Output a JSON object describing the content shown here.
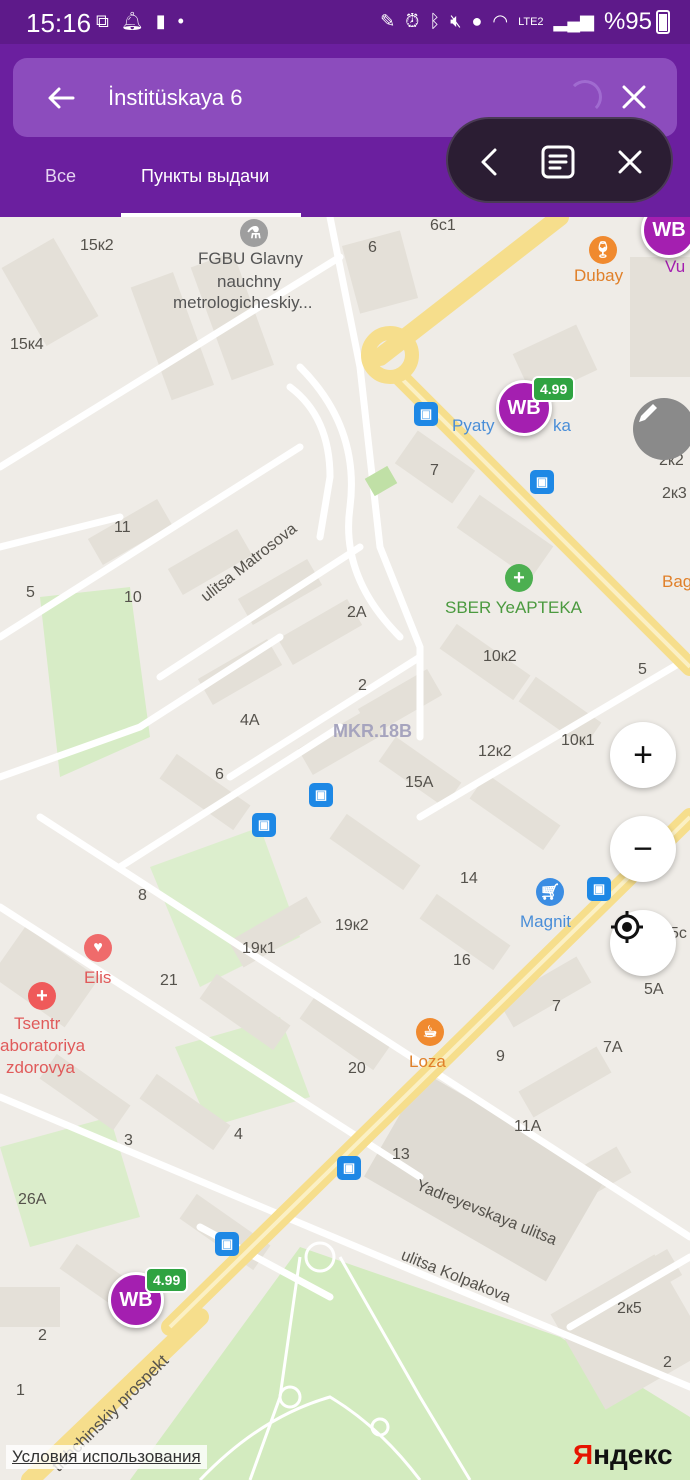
{
  "status_bar": {
    "time": "15:16",
    "battery": "%95",
    "network": "LTE2"
  },
  "search": {
    "query": "İnstitüskaya 6"
  },
  "tabs": [
    {
      "label": "Все"
    },
    {
      "label": "Пункты выдачи"
    }
  ],
  "nav_pill": {
    "back_icon": "chevron-left-icon",
    "list_icon": "list-icon",
    "close_icon": "close-icon"
  },
  "map": {
    "district": "MKR.18B",
    "streets": {
      "matrosova": "ulitsa Matrosova",
      "yadreyevskaya": "Yadreyevskaya ulitsa",
      "kolpakova": "ulitsa Kolpakova",
      "prospekt": "tishchinskiy prospekt"
    },
    "pois": {
      "fgbu_line1": "FGBU Glavny",
      "fgbu_line2": "nauchny",
      "fgbu_line3": "metrologicheskiy...",
      "dubay": "Dubay",
      "vu": "Vu",
      "pyaterochka": "Pyatyorochka",
      "pyat_start": "Pyaty",
      "pyat_end": "ka",
      "sber": "SBER YeAPTEKA",
      "bag": "Bag",
      "magnit": "Magnit",
      "elis": "Elis",
      "tsentr1": "Tsentr",
      "tsentr2": "aboratoriya",
      "tsentr3": "zdorovya",
      "loza": "Loza"
    },
    "house_numbers": {
      "h15k2": "15к2",
      "h6top": "6",
      "h6c1": "6с1",
      "h15k4": "15к4",
      "h7": "7",
      "h2k2": "2к2",
      "h2k3": "2к3",
      "h11": "11",
      "h5left": "5",
      "h10": "10",
      "h2a": "2А",
      "h10k2": "10к2",
      "h2": "2",
      "h4a": "4А",
      "h5right": "5",
      "h10k1": "10к1",
      "h12k2": "12к2",
      "h6mid": "6",
      "h15a": "15А",
      "h14": "14",
      "h8": "8",
      "h19k2": "19к2",
      "h19k1": "19к1",
      "h5c": "5с",
      "h16": "16",
      "h21": "21",
      "h5a": "5А",
      "h7b": "7",
      "h7a": "7А",
      "h20": "20",
      "h9": "9",
      "h11a": "11А",
      "h3": "3",
      "h4": "4",
      "h13": "13",
      "h26a": "26А",
      "h2k5": "2к5",
      "h2bl": "2",
      "h1": "1",
      "h2br": "2"
    },
    "wb_markers": [
      {
        "label": "WB",
        "price": "4.99"
      },
      {
        "label": "WB",
        "price": "4.99"
      },
      {
        "label": "WB"
      }
    ],
    "controls": {
      "zoom_in": "+",
      "zoom_out": "−"
    },
    "terms_link": "Условия использования",
    "brand": "Яндекс"
  },
  "colors": {
    "header": "#6b1f9f",
    "search_box": "#8c4cbd",
    "wb": "#a41fb0",
    "price_badge": "#2fa341",
    "bus_stop": "#1e88e5"
  }
}
